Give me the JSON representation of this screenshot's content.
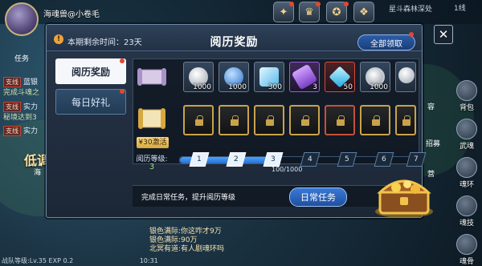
{
  "hud": {
    "player_name": "海魂兽@小卷毛",
    "location": "星斗森林深处",
    "line": "1线",
    "left_tab": "任务",
    "quests": [
      {
        "tag": "支线",
        "text": "蓝银"
      },
      {
        "tag": "",
        "text": "完成斗魂之"
      },
      {
        "tag": "支线",
        "text": "实力"
      },
      {
        "tag": "",
        "text": "秘境达到3"
      },
      {
        "tag": "支线",
        "text": "实力"
      }
    ],
    "right_buttons": [
      "背包",
      "武魂",
      "魂环",
      "魂技",
      "魂骨"
    ],
    "partial_labels": [
      "容",
      "营",
      "招募",
      "低调",
      "海"
    ],
    "chat": [
      "银色满际:你这咋才9万",
      "银色满际:90万",
      "北冥有道:有人剧魂环吗"
    ],
    "status": {
      "level": "战队等级:Lv.35",
      "exp": "EXP 0.2",
      "time": "10:31"
    }
  },
  "dialog": {
    "time_icon": "!",
    "time_label": "本期剩余时间：23天",
    "title": "阅历奖励",
    "claim_all_label": "全部领取",
    "close_label": "✕",
    "tabs": [
      {
        "label": "阅历奖励",
        "active": true
      },
      {
        "label": "每日好礼",
        "active": false
      }
    ],
    "free_rewards": [
      {
        "name": "silver-coin",
        "qty": "1000",
        "color": "#d9dde3"
      },
      {
        "name": "blue-rune",
        "qty": "1000",
        "color": "#4fa3ff"
      },
      {
        "name": "crystal-pile",
        "qty": "300",
        "color": "#7fd6ff"
      },
      {
        "name": "purple-scroll",
        "qty": "3",
        "color": "#b05cff"
      },
      {
        "name": "diamond",
        "qty": "50",
        "color": "#38d5ff"
      },
      {
        "name": "silver-medal",
        "qty": "1000",
        "color": "#e8e8e8"
      },
      {
        "name": "coin-pile",
        "qty": "",
        "color": "#d9dde3"
      }
    ],
    "paid_rewards": [
      {
        "name": "locked-reward",
        "border": "gold"
      },
      {
        "name": "locked-reward",
        "border": "gold"
      },
      {
        "name": "locked-reward",
        "border": "gold"
      },
      {
        "name": "locked-reward",
        "border": "gold"
      },
      {
        "name": "locked-reward",
        "border": "red"
      },
      {
        "name": "locked-reward",
        "border": "gold"
      },
      {
        "name": "locked-reward",
        "border": "gold"
      }
    ],
    "price_badge": "¥30激活",
    "level_label": "阅历等级:",
    "level_value": "3",
    "level_nodes": [
      "1",
      "2",
      "3",
      "4",
      "5",
      "6",
      "7"
    ],
    "progress": {
      "current": 100,
      "max": 1000,
      "text": "100/1000",
      "completed_nodes": 3
    },
    "task_text": "完成日常任务，提升阅历等级",
    "daily_task_label": "日常任务"
  },
  "colors": {
    "accent": "#2a6fcd",
    "gold": "#c9a34a",
    "red_dot": "#e8452f"
  }
}
